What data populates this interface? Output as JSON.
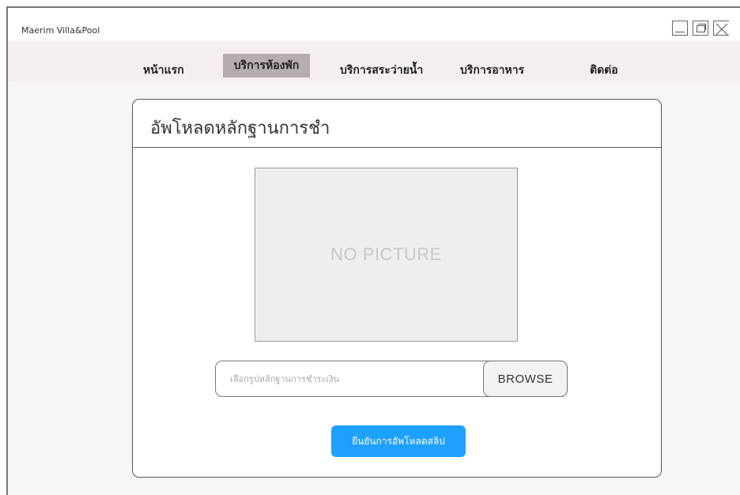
{
  "window": {
    "title": "Maerim Villa&Pool"
  },
  "navbar": {
    "items": [
      {
        "label": "หน้าแรก"
      },
      {
        "label": "บริการห้องพัก",
        "active": true
      },
      {
        "label": "บริการสระว่ายน้ำ"
      },
      {
        "label": "บริการอาหาร"
      },
      {
        "label": "ติดต่อ"
      }
    ]
  },
  "upload": {
    "title": "อัพโหลดหลักฐานการชำ",
    "picture_placeholder": "NO PICTURE",
    "file_placeholder": "เลือกรูปหลักฐานการชำระเงิน",
    "browse_label": "BROWSE",
    "confirm_label": "ยืนยันการอัพโหลดสลิป"
  },
  "colors": {
    "accent": "#1ea0ff",
    "nav_bg": "#f5eeee",
    "nav_active": "#b5adad"
  }
}
